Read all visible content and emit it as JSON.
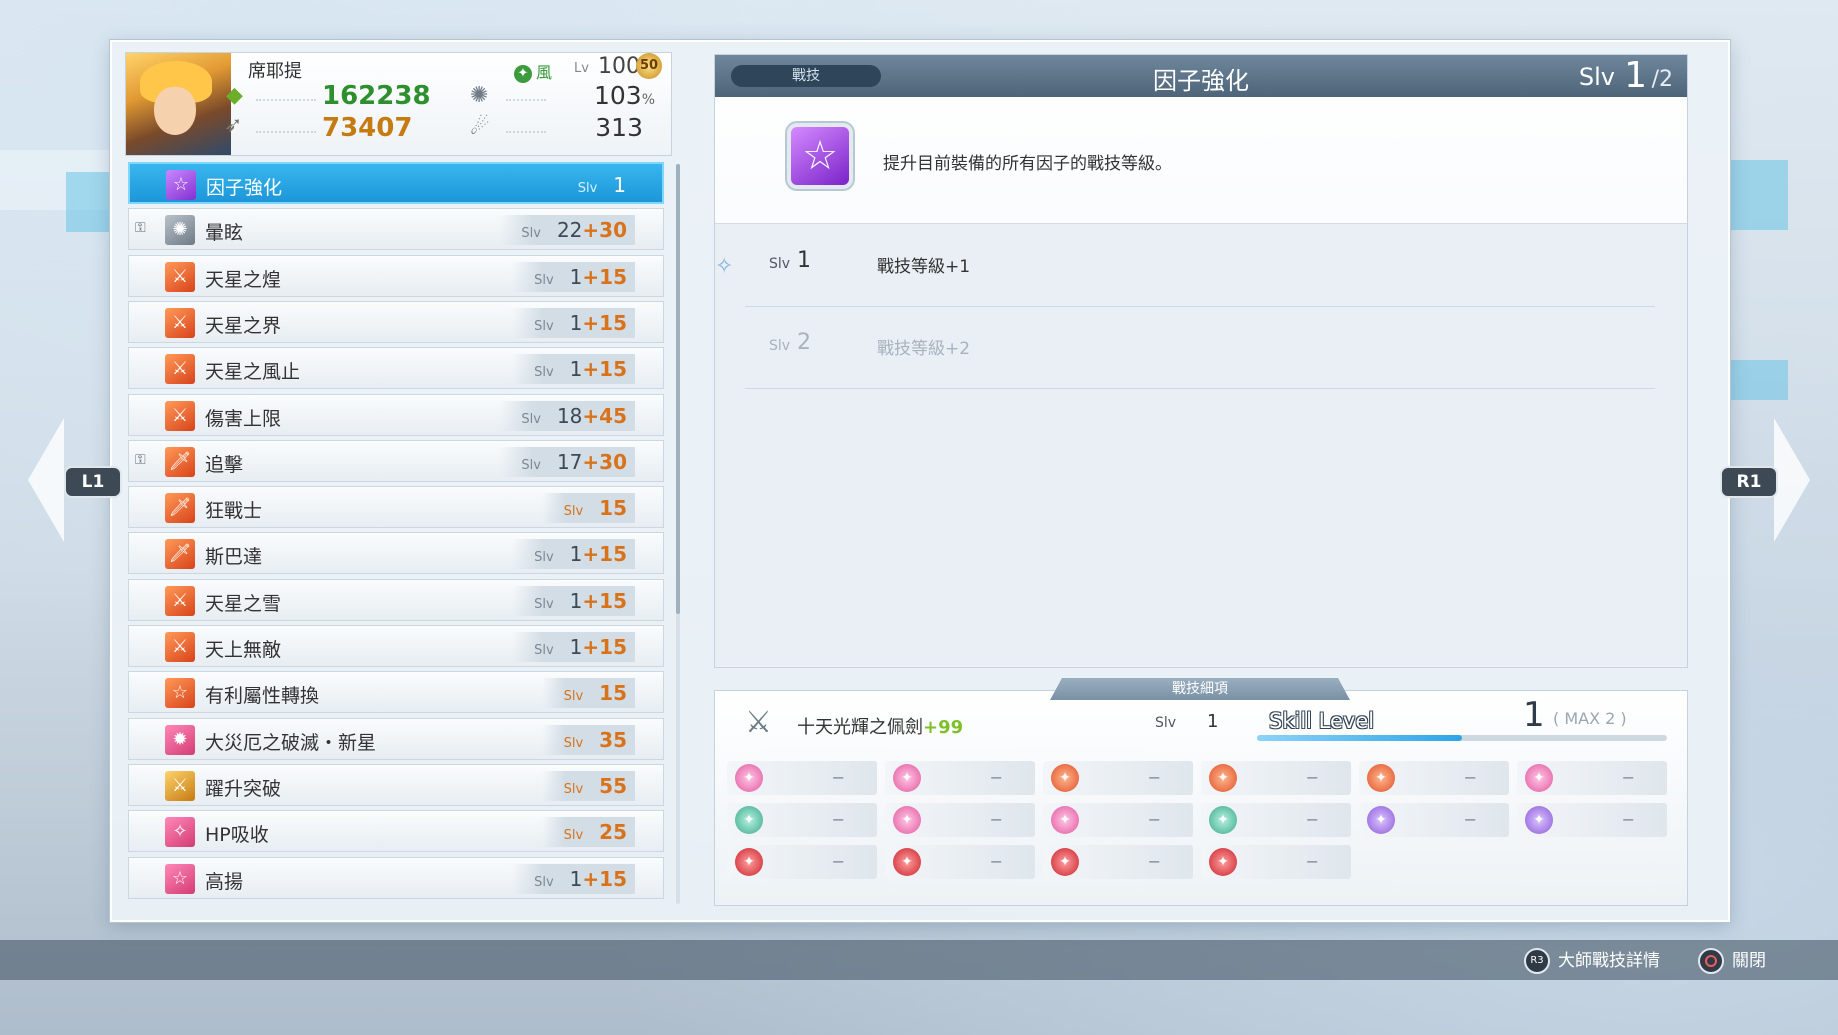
{
  "character": {
    "name": "席耶提",
    "element": "風",
    "level_label": "Lv",
    "level": "100",
    "awakening": "50",
    "hp": "162238",
    "attack": "73407",
    "crit": "103",
    "crit_unit": "%",
    "stamina": "313"
  },
  "skill_list": {
    "items": [
      {
        "name": "因子強化",
        "slv_label": "Slv",
        "base": "1",
        "bonus": "",
        "locked": false,
        "icon": "star-icon",
        "color": "purple",
        "selected": true,
        "max": false
      },
      {
        "name": "暈眩",
        "slv_label": "Slv",
        "base": "22",
        "bonus": "+30",
        "locked": true,
        "icon": "stun-icon",
        "color": "gray",
        "selected": false,
        "max": false
      },
      {
        "name": "天星之煌",
        "slv_label": "Slv",
        "base": "1",
        "bonus": "+15",
        "locked": false,
        "icon": "sword-burst-icon",
        "color": "orange",
        "selected": false,
        "max": false
      },
      {
        "name": "天星之界",
        "slv_label": "Slv",
        "base": "1",
        "bonus": "+15",
        "locked": false,
        "icon": "sword-burst-icon",
        "color": "orange",
        "selected": false,
        "max": false
      },
      {
        "name": "天星之風止",
        "slv_label": "Slv",
        "base": "1",
        "bonus": "+15",
        "locked": false,
        "icon": "sword-burst-icon",
        "color": "orange",
        "selected": false,
        "max": false
      },
      {
        "name": "傷害上限",
        "slv_label": "Slv",
        "base": "18",
        "bonus": "+45",
        "locked": false,
        "icon": "sword-burst-icon",
        "color": "orange",
        "selected": false,
        "max": false
      },
      {
        "name": "追擊",
        "slv_label": "Slv",
        "base": "17",
        "bonus": "+30",
        "locked": true,
        "icon": "sword-icon",
        "color": "orange",
        "selected": false,
        "max": false
      },
      {
        "name": "狂戰士",
        "slv_label": "Slv",
        "base": "15",
        "bonus": "",
        "locked": false,
        "icon": "sword-icon",
        "color": "orange",
        "selected": false,
        "max": true
      },
      {
        "name": "斯巴達",
        "slv_label": "Slv",
        "base": "1",
        "bonus": "+15",
        "locked": false,
        "icon": "sword-icon",
        "color": "orange",
        "selected": false,
        "max": false
      },
      {
        "name": "天星之雪",
        "slv_label": "Slv",
        "base": "1",
        "bonus": "+15",
        "locked": false,
        "icon": "sword-burst-icon",
        "color": "orange",
        "selected": false,
        "max": false
      },
      {
        "name": "天上無敵",
        "slv_label": "Slv",
        "base": "1",
        "bonus": "+15",
        "locked": false,
        "icon": "sword-burst-icon",
        "color": "orange",
        "selected": false,
        "max": false
      },
      {
        "name": "有利屬性轉換",
        "slv_label": "Slv",
        "base": "15",
        "bonus": "",
        "locked": false,
        "icon": "star-icon",
        "color": "orange",
        "selected": false,
        "max": true
      },
      {
        "name": "大災厄之破滅・新星",
        "slv_label": "Slv",
        "base": "35",
        "bonus": "",
        "locked": false,
        "icon": "nova-icon",
        "color": "pink",
        "selected": false,
        "max": true
      },
      {
        "name": "躍升突破",
        "slv_label": "Slv",
        "base": "55",
        "bonus": "",
        "locked": false,
        "icon": "sword-burst-icon",
        "color": "gold",
        "selected": false,
        "max": true
      },
      {
        "name": "HP吸收",
        "slv_label": "Slv",
        "base": "25",
        "bonus": "",
        "locked": false,
        "icon": "heart-drain-icon",
        "color": "pink",
        "selected": false,
        "max": true
      },
      {
        "name": "高揚",
        "slv_label": "Slv",
        "base": "1",
        "bonus": "+15",
        "locked": false,
        "icon": "star-icon",
        "color": "pink",
        "selected": false,
        "max": false
      }
    ]
  },
  "detail": {
    "category": "戰技",
    "title": "因子強化",
    "slv_label": "Slv",
    "slv_current": "1",
    "slv_max": "/2",
    "description": "提升目前裝備的所有因子的戰技等級。",
    "levels": [
      {
        "slv_label": "Slv",
        "num": "1",
        "effect": "戰技等級+1",
        "current": true
      },
      {
        "slv_label": "Slv",
        "num": "2",
        "effect": "戰技等級+2",
        "current": false
      }
    ]
  },
  "weapon": {
    "tab_label": "戰技細項",
    "name": "十天光輝之佩劍",
    "plus": "+99",
    "slv_label": "Slv",
    "slv": "1",
    "skill_level_label": "Skill Level",
    "skill_level": "1",
    "skill_level_max": "( MAX 2 )",
    "skill_level_progress": 0.5,
    "slot_dash": "−"
  },
  "nav": {
    "left": "L1",
    "right": "R1"
  },
  "footer": {
    "master_detail": "大師戰技詳情",
    "close": "關閉",
    "r3": "R3"
  },
  "colors": {
    "selected": "#1c96d8",
    "bonus": "#d8731c",
    "hp": "#2d8f2d",
    "attack": "#c57a12"
  }
}
